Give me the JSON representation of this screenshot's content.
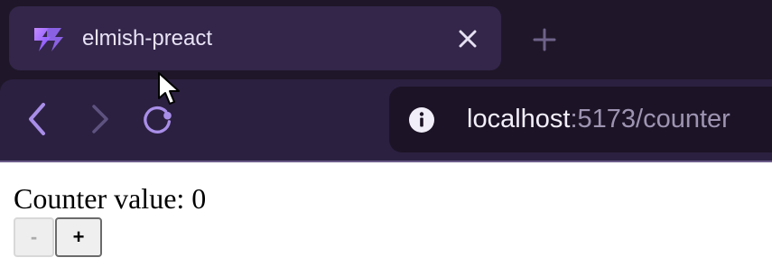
{
  "browser": {
    "tab": {
      "title": "elmish-preact",
      "favicon": "vite-logo-icon"
    },
    "address": {
      "host": "localhost",
      "rest": ":5173/counter"
    },
    "colors": {
      "tabstrip": "#1f1729",
      "active_tab": "#33264a",
      "toolbar": "#2b2040",
      "urlbar": "#1c1426",
      "accent": "#a98ee8"
    }
  },
  "page": {
    "counter_label": "Counter value: 0",
    "decrement_label": "-",
    "increment_label": "+"
  }
}
